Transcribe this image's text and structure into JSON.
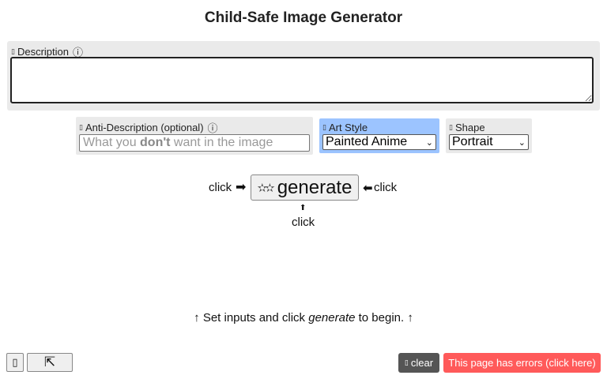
{
  "title": "Child-Safe Image Generator",
  "description": {
    "label": "Description",
    "value": ""
  },
  "anti_description": {
    "label": "Anti-Description (optional)",
    "placeholder_pre": "What you ",
    "placeholder_bold": "don't",
    "placeholder_post": " want in the image"
  },
  "art_style": {
    "label": "Art Style",
    "selected": "Painted Anime"
  },
  "shape": {
    "label": "Shape",
    "selected": "Portrait"
  },
  "generate": {
    "label": "generate",
    "click_left": "click",
    "click_right": "click",
    "click_below": "click",
    "arrow_right": "➡",
    "arrow_left": "⬅",
    "arrow_up": "⬆"
  },
  "hint": {
    "prefix": "↑ Set inputs and click ",
    "emph": "generate",
    "suffix": " to begin. ↑"
  },
  "footer": {
    "btn1_glyph": "▯",
    "btn2_glyph": "⇱",
    "clear_label": "clear",
    "errors_label": "This page has errors (click here)"
  },
  "colors": {
    "panel_bg": "#eaeaea",
    "art_style_bg": "#9cc4ff",
    "clear_bg": "#555555",
    "error_bg": "#ff5a5a"
  },
  "icons": [
    "info-icon",
    "sparkle-icon",
    "label-glyph"
  ]
}
